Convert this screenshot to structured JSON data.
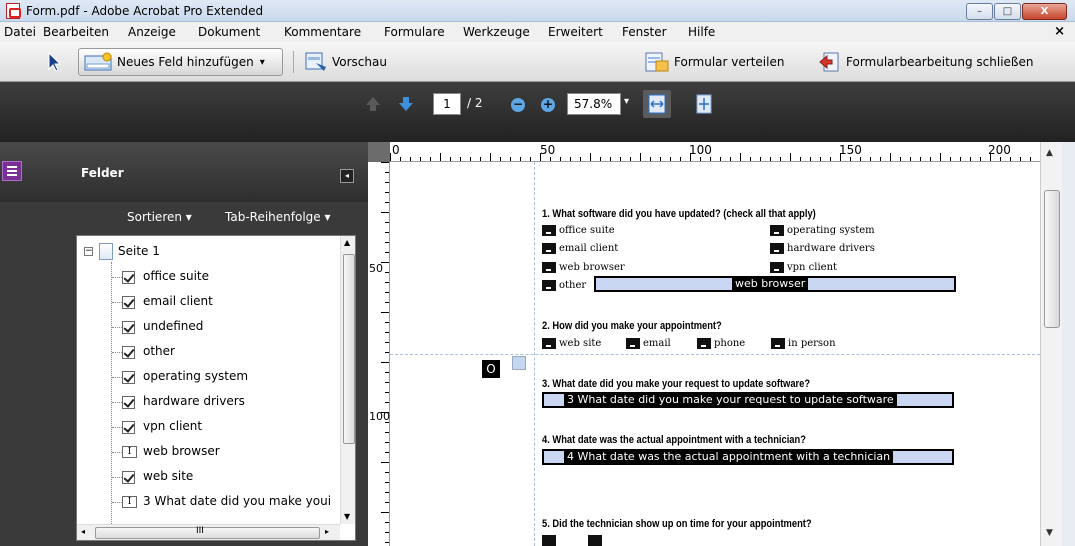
{
  "window": {
    "title": "Form.pdf - Adobe Acrobat Pro Extended",
    "min_label": "–",
    "max_label": "□",
    "close_label": "X"
  },
  "menu": {
    "items": [
      "Datei",
      "Bearbeiten",
      "Anzeige",
      "Dokument",
      "Kommentare",
      "Formulare",
      "Werkzeuge",
      "Erweitert",
      "Fenster",
      "Hilfe"
    ],
    "close_label": "×"
  },
  "toolbar": {
    "add_field_label": "Neues Feld hinzufügen",
    "preview_label": "Vorschau",
    "distribute_label": "Formular verteilen",
    "close_edit_label": "Formularbearbeitung schließen",
    "dropdown_glyph": "▾"
  },
  "navigation": {
    "current_page": "1",
    "total_pages": "/ 2",
    "zoom": "57.8%"
  },
  "fields_panel": {
    "title": "Felder",
    "sort_label": "Sortieren ▾",
    "tab_order_label": "Tab-Reihenfolge ▾",
    "page_label": "Seite 1",
    "items": [
      {
        "label": "office suite",
        "type": "checkbox"
      },
      {
        "label": "email client",
        "type": "checkbox"
      },
      {
        "label": "undefined",
        "type": "checkbox"
      },
      {
        "label": "other",
        "type": "checkbox"
      },
      {
        "label": "operating system",
        "type": "checkbox"
      },
      {
        "label": "hardware drivers",
        "type": "checkbox"
      },
      {
        "label": "vpn client",
        "type": "checkbox"
      },
      {
        "label": "web browser",
        "type": "text"
      },
      {
        "label": "web site",
        "type": "checkbox"
      },
      {
        "label": "3 What date did you make youi",
        "type": "text"
      }
    ],
    "hscroll_glyph": "III"
  },
  "ruler": {
    "h_labels": [
      "0",
      "50",
      "100",
      "150",
      "200"
    ],
    "v_labels": [
      "50",
      "100"
    ]
  },
  "document": {
    "q1": "1. What software did you have updated? (check all that apply)",
    "q1_opts_left": [
      "office suite",
      "email client",
      "web browser",
      "other"
    ],
    "q1_opts_right": [
      "operating system",
      "hardware drivers",
      "vpn client"
    ],
    "q1_other_field": "web browser",
    "q2": "2. How did you make your appointment?",
    "q2_opts": [
      "web site",
      "email",
      "phone",
      "in person"
    ],
    "q3": "3. What date did you make your request to update software?",
    "q3_field": "3 What date did you make your request to update software",
    "q4": "4. What date was the actual appointment with a technician?",
    "q4_field": "4 What date was the actual appointment with a technician",
    "q5": "5. Did the technician show up on time for your appointment?",
    "marker_o": "O"
  }
}
